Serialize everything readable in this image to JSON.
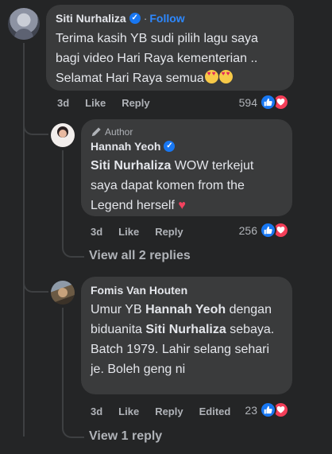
{
  "comment": {
    "author": "Siti Nurhaliza",
    "separator": "·",
    "follow_label": "Follow",
    "text_lines": [
      "Terima kasih YB sudi pilih lagu saya",
      "bagi video Hari Raya kementerian ..",
      "Selamat Hari Raya semua"
    ],
    "emoji": "heart-eyes-emoji",
    "time": "3d",
    "like_label": "Like",
    "reply_label": "Reply",
    "reaction_count": "594",
    "reaction_icons": [
      "like-icon",
      "love-icon"
    ]
  },
  "reply1": {
    "badge": "Author",
    "author": "Hannah Yeoh",
    "mention": "Siti Nurhaliza",
    "text_after_mention": " WOW terkejut saya dapat komen from the Legend herself",
    "emoji": "red-heart-emoji",
    "time": "3d",
    "like_label": "Like",
    "reply_label": "Reply",
    "reaction_count": "256",
    "reaction_icons": [
      "like-icon",
      "love-icon"
    ]
  },
  "view_replies_1": "View all 2 replies",
  "reply2": {
    "author": "Fomis Van Houten",
    "text_1": "Umur YB ",
    "mention_1": "Hannah Yeoh",
    "text_2": " dengan biduanita ",
    "mention_2": "Siti Nurhaliza",
    "text_3": " sebaya. Batch 1979. Lahir selang sehari je. Boleh geng ni",
    "time": "3d",
    "like_label": "Like",
    "reply_label": "Reply",
    "edited_label": "Edited",
    "reaction_count": "23",
    "reaction_icons": [
      "like-icon",
      "love-icon"
    ]
  },
  "view_replies_2": "View 1 reply",
  "colors": {
    "background": "#242526",
    "bubble": "#3a3b3c",
    "link_blue": "#2d88ff",
    "verified_blue": "#1877f2",
    "love_red": "#f33e58",
    "muted_text": "#b0b3b8"
  }
}
